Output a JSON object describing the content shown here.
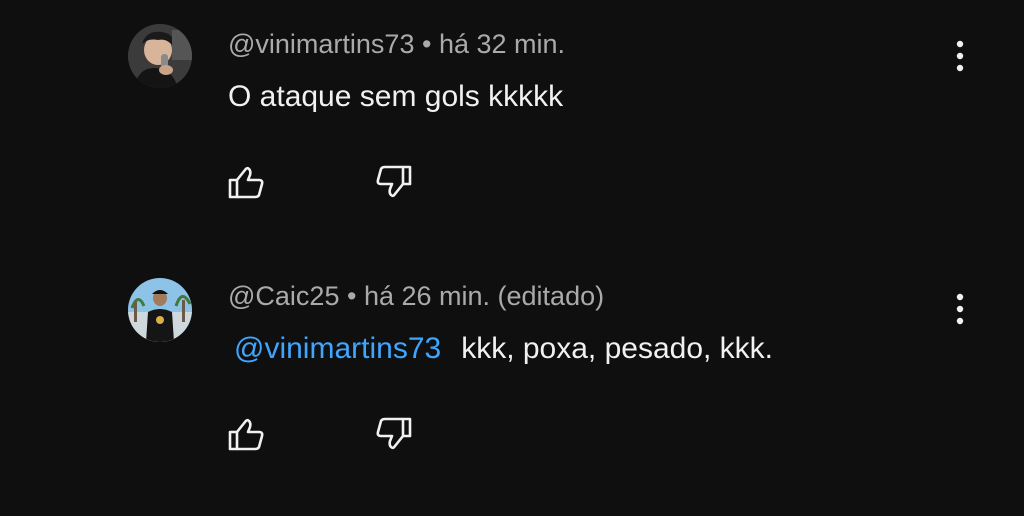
{
  "comments": [
    {
      "author": "@vinimartins73",
      "separator": "•",
      "time": "há 32 min.",
      "text": "O ataque sem gols kkkkk",
      "avatar_icon": "user-avatar-photo"
    },
    {
      "author": "@Caic25",
      "separator": "•",
      "time": "há 26 min. (editado)",
      "mention": "@vinimartins73",
      "text": "kkk, poxa, pesado, kkk.",
      "avatar_icon": "user-avatar-photo"
    }
  ],
  "icons": {
    "like": "thumbs-up-icon",
    "dislike": "thumbs-down-icon",
    "menu": "more-vertical-icon"
  },
  "colors": {
    "background": "#0f0f0f",
    "text_primary": "#f1f1f1",
    "text_secondary": "#aaaaaa",
    "mention": "#3ea6ff"
  }
}
